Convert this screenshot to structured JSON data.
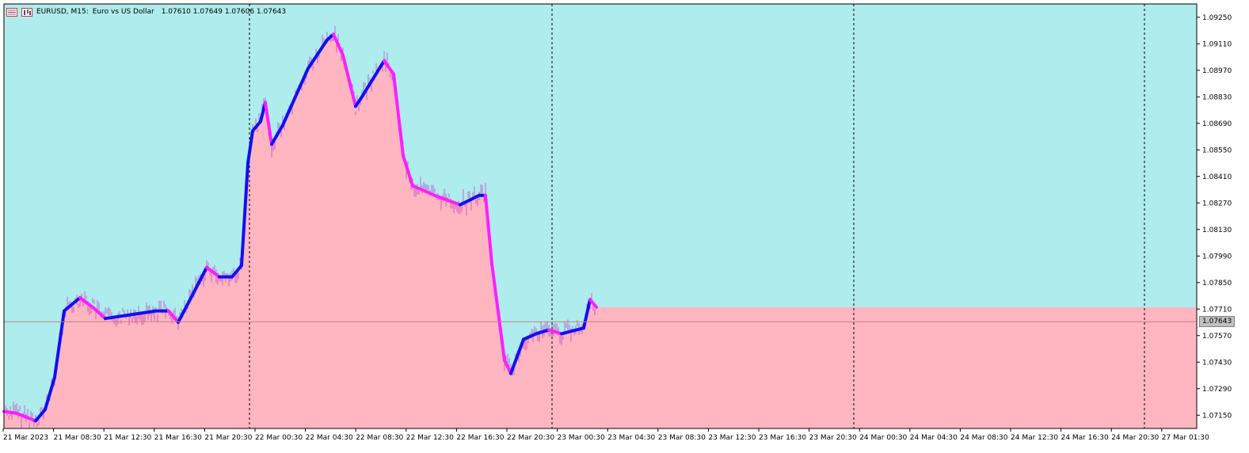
{
  "header": {
    "symbol": "EURUSD, M15:",
    "description": "Euro vs US Dollar",
    "ohlc": "1.07610 1.07649 1.07606 1.07643"
  },
  "colors": {
    "upper_background": "#afecee",
    "lower_fill": "#ffb6c1",
    "ma_up": "#1010f0",
    "ma_down": "#ff20ff",
    "candle": "#c040c0",
    "price_line": "#c08080"
  },
  "chart_data": {
    "type": "line",
    "ylim": [
      1.0708,
      1.0932
    ],
    "y_ticks": [
      "1.09250",
      "1.09110",
      "1.08970",
      "1.08830",
      "1.08690",
      "1.08550",
      "1.08410",
      "1.08270",
      "1.08130",
      "1.07990",
      "1.07850",
      "1.07710",
      "1.07570",
      "1.07430",
      "1.07290",
      "1.07150"
    ],
    "x_ticks": [
      "21 Mar 2023",
      "21 Mar 08:30",
      "21 Mar 12:30",
      "21 Mar 16:30",
      "21 Mar 20:30",
      "22 Mar 00:30",
      "22 Mar 04:30",
      "22 Mar 08:30",
      "22 Mar 12:30",
      "22 Mar 16:30",
      "22 Mar 20:30",
      "23 Mar 00:30",
      "23 Mar 04:30",
      "23 Mar 08:30",
      "23 Mar 12:30",
      "23 Mar 16:30",
      "23 Mar 20:30",
      "24 Mar 00:30",
      "24 Mar 04:30",
      "24 Mar 08:30",
      "24 Mar 12:30",
      "24 Mar 16:30",
      "24 Mar 20:30",
      "27 Mar 01:30"
    ],
    "day_separators": [
      "22 Mar",
      "23 Mar",
      "24 Mar",
      "27 Mar"
    ],
    "current_price": "1.07643",
    "series": [
      {
        "x": [
          "21 Mar 04:30",
          "21 Mar 06:30",
          "21 Mar 08:00",
          "21 Mar 09:30",
          "21 Mar 11:00",
          "21 Mar 12:30",
          "21 Mar 14:00",
          "21 Mar 16:30",
          "21 Mar 18:30",
          "21 Mar 20:30",
          "22 Mar 00:30",
          "22 Mar 04:30",
          "22 Mar 06:30",
          "22 Mar 08:00",
          "22 Mar 10:30",
          "22 Mar 12:30",
          "22 Mar 14:30",
          "22 Mar 16:30",
          "22 Mar 18:00",
          "22 Mar 19:00",
          "22 Mar 19:45",
          "22 Mar 21:00",
          "22 Mar 21:45",
          "22 Mar 22:45",
          "23 Mar 00:30",
          "23 Mar 04:30",
          "23 Mar 07:30",
          "23 Mar 08:30",
          "23 Mar 10:00",
          "23 Mar 12:00",
          "23 Mar 13:00",
          "23 Mar 16:30",
          "23 Mar 18:00",
          "23 Mar 19:30",
          "23 Mar 21:00",
          "24 Mar 00:30",
          "24 Mar 04:30",
          "24 Mar 07:30",
          "24 Mar 08:30",
          "24 Mar 09:30",
          "24 Mar 11:30",
          "24 Mar 12:30",
          "24 Mar 14:30",
          "24 Mar 16:30",
          "24 Mar 18:30",
          "24 Mar 20:30",
          "27 Mar 00:30",
          "27 Mar 01:30",
          "27 Mar 02:30"
        ],
        "y": [
          1.0717,
          1.0716,
          1.0714,
          1.0712,
          1.0718,
          1.0735,
          1.077,
          1.0777,
          1.0772,
          1.0766,
          1.0768,
          1.077,
          1.077,
          1.0764,
          1.078,
          1.0793,
          1.0788,
          1.0788,
          1.0794,
          1.0848,
          1.0865,
          1.087,
          1.088,
          1.0858,
          1.0868,
          1.0898,
          1.0913,
          1.0916,
          1.0905,
          1.0878,
          1.0883,
          1.0902,
          1.0895,
          1.0852,
          1.0836,
          1.0831,
          1.0826,
          1.0831,
          1.0831,
          1.0795,
          1.0744,
          1.0737,
          1.0755,
          1.0758,
          1.076,
          1.0758,
          1.0761,
          1.0776,
          1.0772
        ]
      }
    ]
  }
}
